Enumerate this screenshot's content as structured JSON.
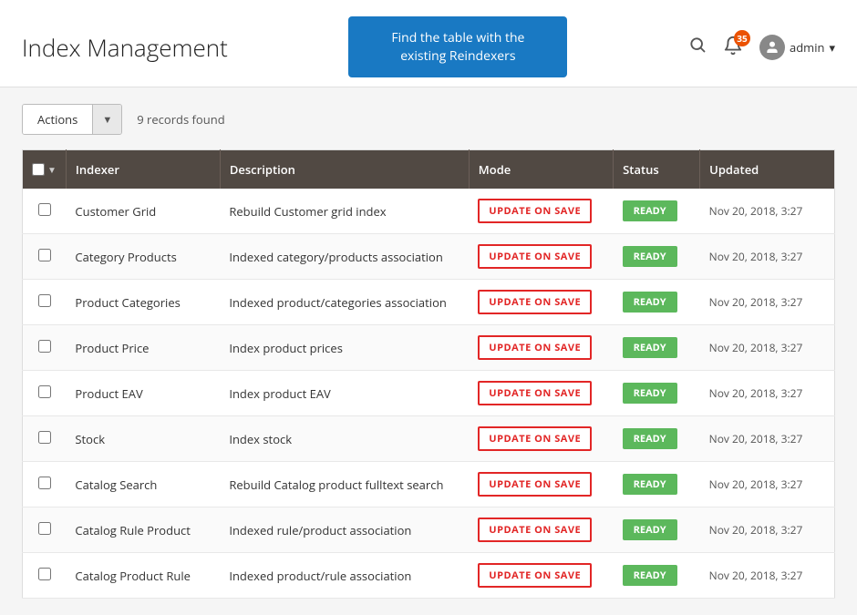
{
  "header": {
    "title": "Index Management",
    "tooltip_banner": "Find the table with the existing Reindexers",
    "search_icon": "🔍",
    "bell_icon": "🔔",
    "bell_badge": "35",
    "user_name": "admin",
    "user_arrow": "▾"
  },
  "toolbar": {
    "actions_label": "Actions",
    "actions_arrow": "▼",
    "records_count": "9 records found"
  },
  "table": {
    "columns": [
      {
        "key": "checkbox",
        "label": ""
      },
      {
        "key": "indexer",
        "label": "Indexer"
      },
      {
        "key": "description",
        "label": "Description"
      },
      {
        "key": "mode",
        "label": "Mode"
      },
      {
        "key": "status",
        "label": "Status"
      },
      {
        "key": "updated",
        "label": "Updated"
      }
    ],
    "rows": [
      {
        "indexer": "Customer Grid",
        "description": "Rebuild Customer grid index",
        "mode": "UPDATE ON SAVE",
        "status": "READY",
        "updated": "Nov 20, 2018, 3:27"
      },
      {
        "indexer": "Category Products",
        "description": "Indexed category/products association",
        "mode": "UPDATE ON SAVE",
        "status": "READY",
        "updated": "Nov 20, 2018, 3:27"
      },
      {
        "indexer": "Product Categories",
        "description": "Indexed product/categories association",
        "mode": "UPDATE ON SAVE",
        "status": "READY",
        "updated": "Nov 20, 2018, 3:27"
      },
      {
        "indexer": "Product Price",
        "description": "Index product prices",
        "mode": "UPDATE ON SAVE",
        "status": "READY",
        "updated": "Nov 20, 2018, 3:27"
      },
      {
        "indexer": "Product EAV",
        "description": "Index product EAV",
        "mode": "UPDATE ON SAVE",
        "status": "READY",
        "updated": "Nov 20, 2018, 3:27"
      },
      {
        "indexer": "Stock",
        "description": "Index stock",
        "mode": "UPDATE ON SAVE",
        "status": "READY",
        "updated": "Nov 20, 2018, 3:27"
      },
      {
        "indexer": "Catalog Search",
        "description": "Rebuild Catalog product fulltext search",
        "mode": "UPDATE ON SAVE",
        "status": "READY",
        "updated": "Nov 20, 2018, 3:27"
      },
      {
        "indexer": "Catalog Rule Product",
        "description": "Indexed rule/product association",
        "mode": "UPDATE ON SAVE",
        "status": "READY",
        "updated": "Nov 20, 2018, 3:27"
      },
      {
        "indexer": "Catalog Product Rule",
        "description": "Indexed product/rule association",
        "mode": "UPDATE ON SAVE",
        "status": "READY",
        "updated": "Nov 20, 2018, 3:27"
      }
    ]
  }
}
